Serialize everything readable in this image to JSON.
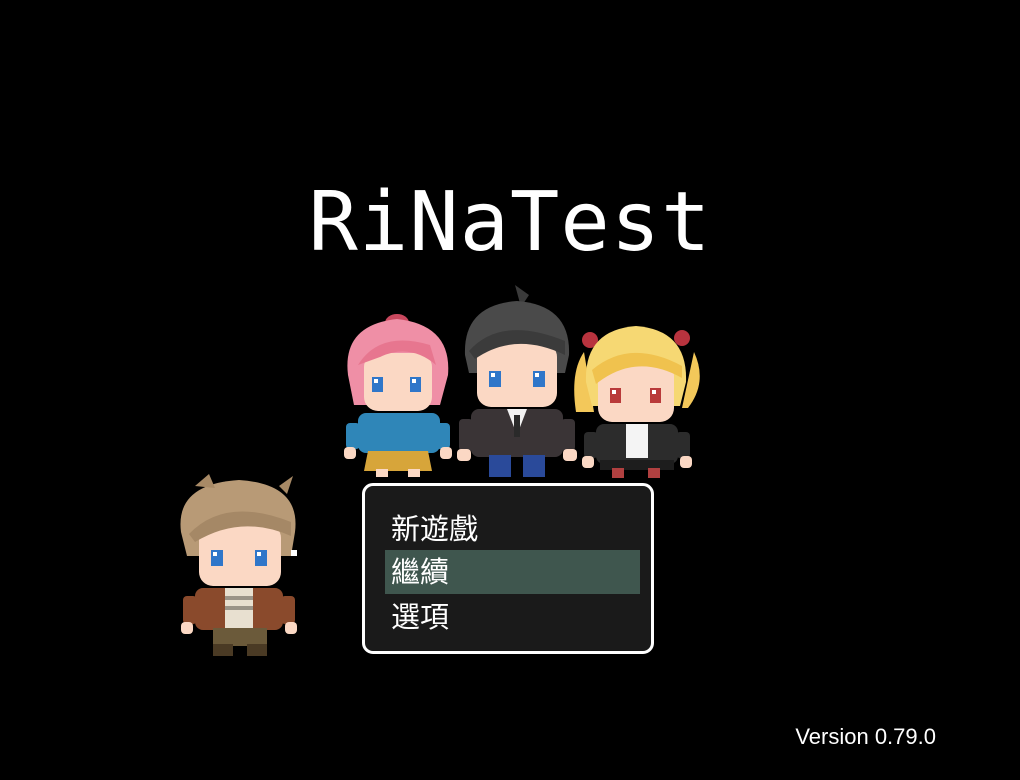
{
  "title": "RiNaTest",
  "menu": {
    "items": [
      {
        "label": "新遊戲",
        "selected": false
      },
      {
        "label": "繼續",
        "selected": true
      },
      {
        "label": "選項",
        "selected": false
      }
    ]
  },
  "version": "Version 0.79.0",
  "characters": [
    {
      "name": "pink-hair-girl-sprite"
    },
    {
      "name": "dark-hair-boy-sprite"
    },
    {
      "name": "blonde-twintail-girl-sprite"
    },
    {
      "name": "brown-hair-boy-sprite"
    }
  ],
  "colors": {
    "background": "#000000",
    "menu_highlight": "#3f564e",
    "window_border": "#ffffff"
  }
}
